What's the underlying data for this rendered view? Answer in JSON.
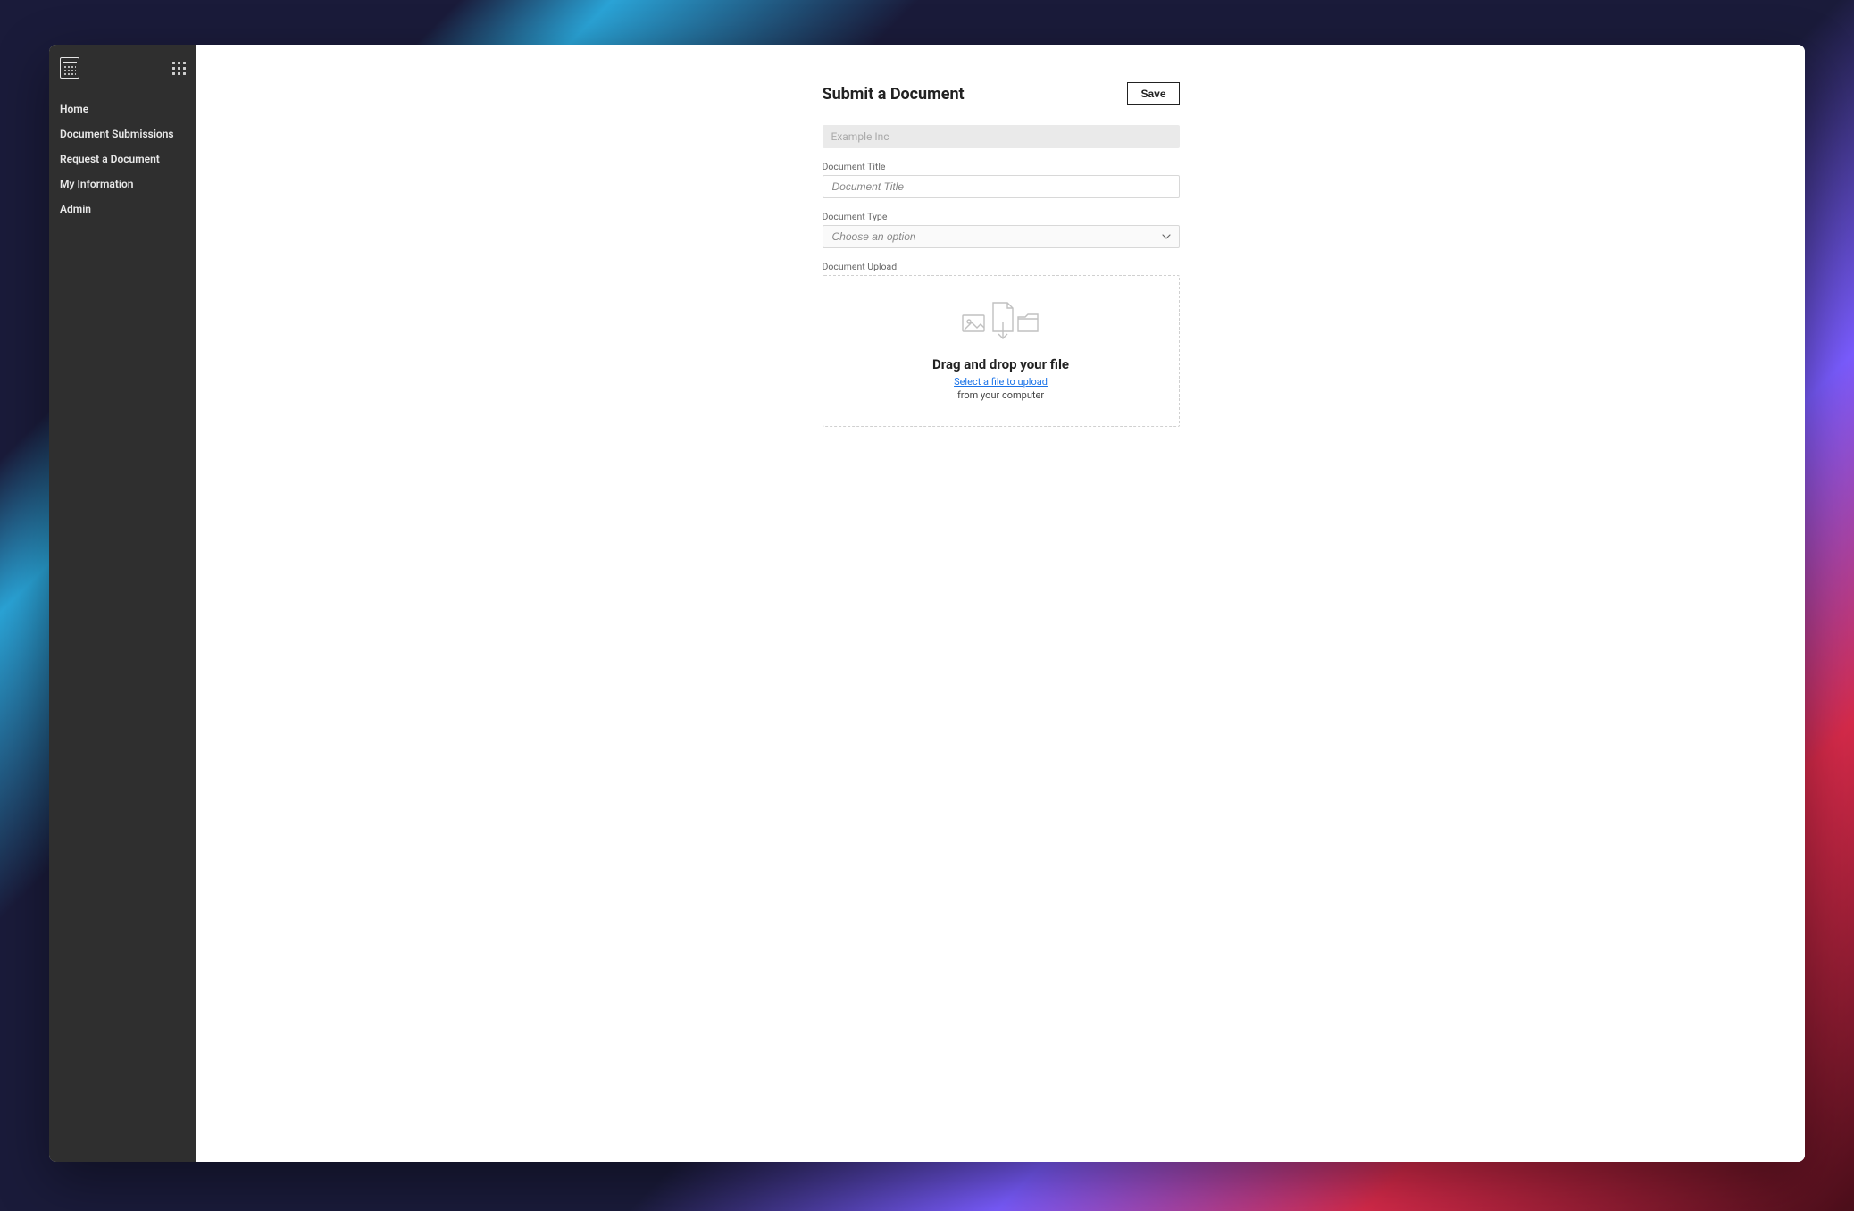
{
  "sidebar": {
    "items": [
      {
        "label": "Home"
      },
      {
        "label": "Document Submissions"
      },
      {
        "label": "Request a Document"
      },
      {
        "label": "My Information"
      },
      {
        "label": "Admin"
      }
    ]
  },
  "header": {
    "title": "Submit a Document",
    "save_label": "Save"
  },
  "form": {
    "org_readonly": "Example Inc",
    "doc_title": {
      "label": "Document Title",
      "placeholder": "Document Title",
      "value": ""
    },
    "doc_type": {
      "label": "Document Type",
      "placeholder": "Choose an option",
      "selected": ""
    },
    "upload": {
      "label": "Document Upload",
      "drag_text": "Drag and drop your file",
      "select_link": "Select a file to upload",
      "sub_text": "from your computer"
    }
  }
}
